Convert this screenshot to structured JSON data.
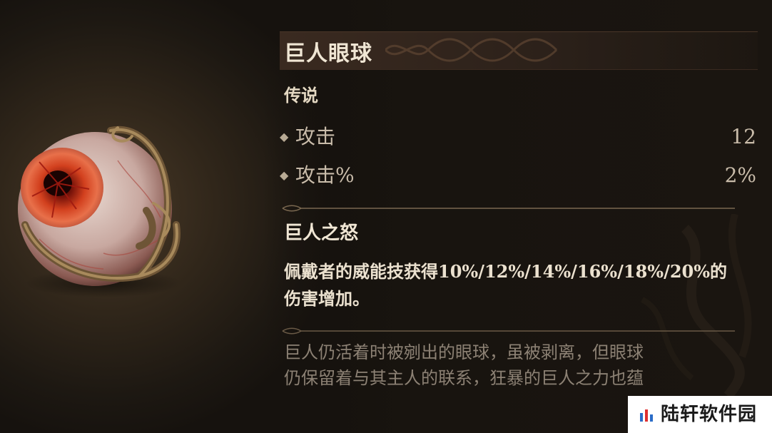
{
  "item": {
    "name": "巨人眼球",
    "rarity": "传说"
  },
  "stats": [
    {
      "label": "攻击",
      "value": "12"
    },
    {
      "label": "攻击%",
      "value": "2%"
    }
  ],
  "aspect": {
    "name": "巨人之怒",
    "description_line1": "佩戴者的威能技获得10%/12%/14%/16%/18%/20%的",
    "description_line2": "伤害增加。"
  },
  "flavor": {
    "line1": "巨人仍活着时被剜出的眼球，虽被剥离，但眼球",
    "line2": "仍保留着与其主人的联系，狂暴的巨人之力也蕴"
  },
  "watermark": {
    "text": "陆轩软件园"
  },
  "colors": {
    "accent_gold": "#b89a6a",
    "eye_red": "#c0321e",
    "panel_bg": "#18140f"
  }
}
